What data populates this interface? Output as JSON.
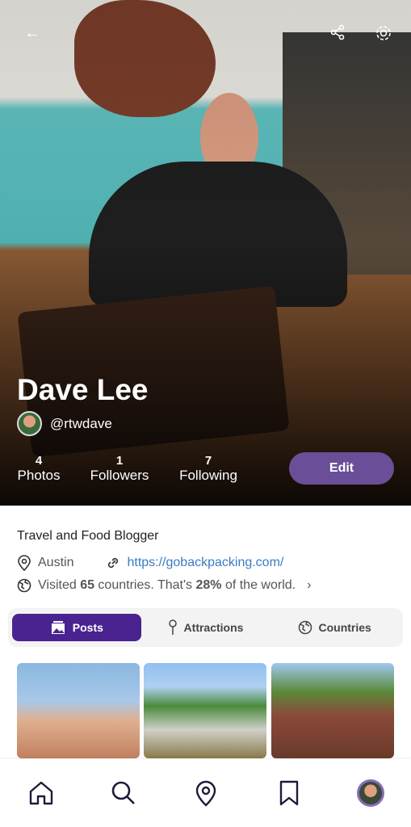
{
  "profile": {
    "name": "Dave Lee",
    "handle": "@rtwdave",
    "stats": [
      {
        "value": "4",
        "label": "Photos"
      },
      {
        "value": "1",
        "label": "Followers"
      },
      {
        "value": "7",
        "label": "Following"
      }
    ],
    "edit_label": "Edit",
    "bio": "Travel and Food Blogger",
    "location": "Austin",
    "website": "https://gobackpacking.com/",
    "visited": {
      "prefix": "Visited ",
      "count": "65",
      "middle": " countries. That's ",
      "percent": "28%",
      "suffix": " of the world."
    }
  },
  "tabs": [
    {
      "label": "Posts",
      "icon": "photos-icon",
      "active": true
    },
    {
      "label": "Attractions",
      "icon": "pin-icon",
      "active": false
    },
    {
      "label": "Countries",
      "icon": "globe-icon",
      "active": false
    }
  ],
  "colors": {
    "accent": "#4a2390",
    "edit_button": "#6a4f98",
    "link": "#3a7cc0"
  },
  "nav": [
    "home-icon",
    "search-icon",
    "location-icon",
    "bookmark-icon",
    "profile-avatar"
  ]
}
